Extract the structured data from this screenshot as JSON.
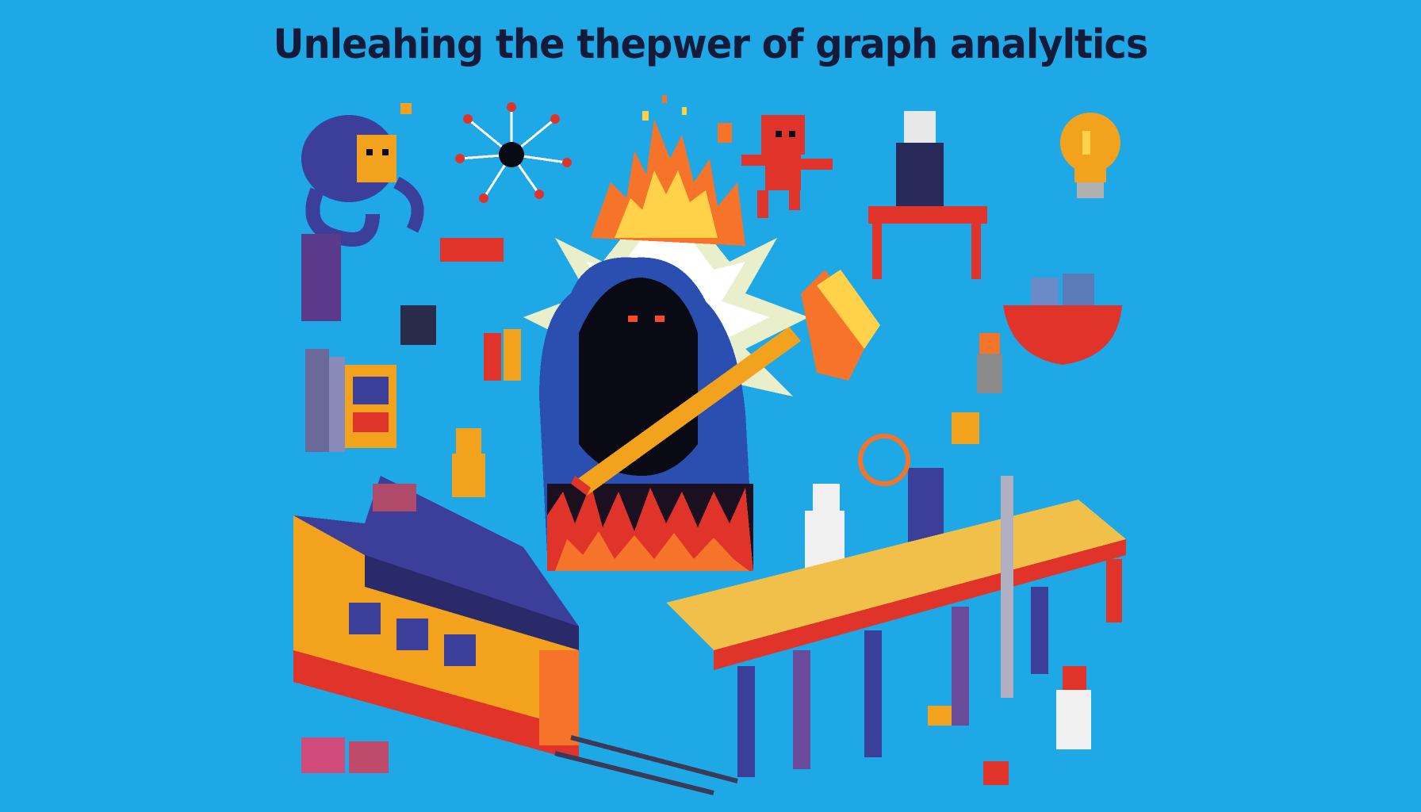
{
  "title": "Unleahing the thepwer of graph analyltics",
  "colors": {
    "background": "#1ea8e6",
    "title_text": "#141a3a",
    "hood": "#2a4fb0",
    "shadow": "#0a0a14",
    "fire_orange": "#f5742a",
    "fire_yellow": "#ffd24a",
    "accent_red": "#e0342a",
    "train_yellow": "#f2a21c",
    "train_blue": "#3b3f9a",
    "bridge_deck": "#f0c04a"
  },
  "scene_elements": [
    "hooded-figure",
    "hammer",
    "fire",
    "burst",
    "train",
    "bridge",
    "lightbulb",
    "octopus-creature",
    "network-node",
    "red-creature",
    "books",
    "bowl",
    "figures"
  ]
}
